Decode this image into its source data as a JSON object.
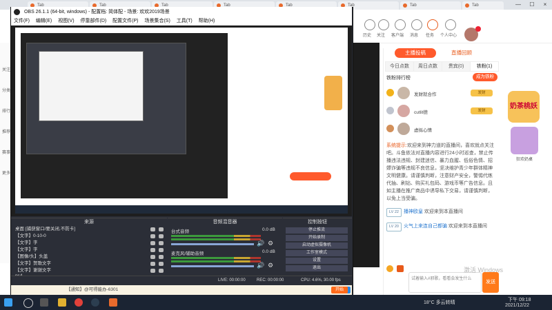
{
  "browser": {
    "tabs": [
      "Tab",
      "Tab",
      "Tab",
      "Tab",
      "Tab",
      "Tab",
      "Tab",
      "Tab"
    ],
    "close": "×",
    "minimize": "—",
    "maximize": "☐"
  },
  "site": {
    "top_icons": [
      {
        "label": "历史"
      },
      {
        "label": "关注"
      },
      {
        "label": "客户端"
      },
      {
        "label": "消息"
      },
      {
        "label": "任务"
      },
      {
        "label": "个人中心"
      }
    ],
    "sidebar": [
      "关注",
      "分类",
      "排行",
      "推荐",
      "赛事",
      "更多"
    ],
    "panel": {
      "tabs": [
        "主播投稿",
        "直播回顾"
      ],
      "rank_tabs": [
        "今日点数",
        "周日点数",
        "贵宾(0)",
        "铁粉(1)"
      ],
      "rank_header": "铁粉排行榜",
      "join_button": "成为铁粉",
      "rows": [
        {
          "name": "发财就合作",
          "badge": "发财"
        },
        {
          "name": "cutlit德",
          "badge": "发财"
        },
        {
          "name": "虚拟心情",
          "badge": ""
        }
      ],
      "system_prefix": "系统提示:",
      "system_text": "欢迎来到神力道的直播间，喜欢就点关注吧。斗鱼依法对直播内容进行24小时巡查，禁止传播违法违规、封建迷信、暴力血腥、低俗色情、招嫖诈骗等违规不良信息，坚决维护青少年群体精神文明健康。请谨慎判断，注意财产安全，警惕代练代抽、刷钻、购买礼包码、游戏币等广告信息。且如主播在推广商品中诱导私下交易，请谨慎判断，以免上当受骗。",
      "chat": [
        {
          "level": "LV 22",
          "nick": "播神欧皇",
          "text": "欢迎来到本直播间"
        },
        {
          "level": "LV 20",
          "nick": "火气上来连自己都骗",
          "text": "欢迎来到本直播间"
        }
      ],
      "input_placeholder": "试着输入#邪歌，看看会发生什么",
      "send": "发送",
      "promo_text": "奶茶桃妖",
      "promo_sub": "狂欢奶桌"
    },
    "watermark": "激活 Windows"
  },
  "obs": {
    "title": "OBS 26.1.1 (64-bit, windows) - 配置档: 简体配 - 场景: 欢欢2019场景",
    "menu": [
      "文件(F)",
      "编辑(E)",
      "视图(V)",
      "停靠部件(D)",
      "配置文件(P)",
      "场景集合(S)",
      "工具(T)",
      "帮助(H)"
    ],
    "docks": {
      "sources_title": "来源",
      "mixer_title": "音频混音器",
      "controls_title": "控制按钮"
    },
    "sources": [
      "桌面 [捕获窗口/要关闭,不防卡]",
      "【文字】0-10-0",
      "【文字】字",
      "【文字】字",
      "【图像/头】头盖",
      "【文字】贺歌文字",
      "【文字】谢谢文字",
      "ps4"
    ],
    "mixer": [
      {
        "name": "台式音频",
        "db": "0.0 dB"
      },
      {
        "name": "麦克风/辅助音频",
        "db": "0.0 dB"
      }
    ],
    "controls": [
      "停止推流",
      "开始录制",
      "启动虚拟摄像机",
      "工作室模式",
      "设置",
      "退出"
    ],
    "status": {
      "live": "LIVE: 00:00:00",
      "rec": "REC: 00:00:00",
      "cpu": "CPU: 4.6%, 30.00 fps"
    },
    "notify": "【通知】@可得能办-6301",
    "right_buttons": [
      "开始",
      "关闭"
    ]
  },
  "taskbar": {
    "weather": "18°C 多云转晴",
    "time": "下午 09:18",
    "date": "2021/12/22"
  }
}
